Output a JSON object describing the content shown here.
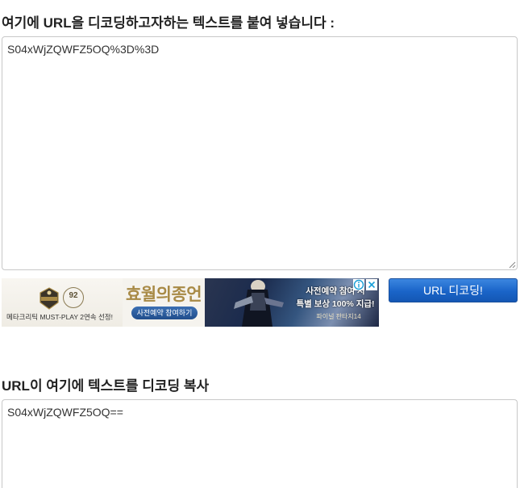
{
  "input_section": {
    "heading": "여기에 URL을 디코딩하고자하는 텍스트를 붙여 넣습니다 :",
    "value": "S04xWjZQWFZ5OQ%3D%3D"
  },
  "decode_button": {
    "label": "URL 디코딩!"
  },
  "ad": {
    "score": "92",
    "caption": "메타크리틱 MUST-PLAY 2연속 선정!",
    "title": "효월의종언",
    "preregister_label": "사전예약 참여하기",
    "reward_line1": "사전예약 참여 시",
    "reward_line2": "특별 보상 100% 지급!",
    "game_logo": "파이널 판타지14",
    "accent_color": "#a88a46"
  },
  "output_section": {
    "heading": "URL이 여기에 텍스트를 디코딩 복사",
    "value": "S04xWjZQWFZ5OQ=="
  },
  "colors": {
    "button": "#1a64c8",
    "text": "#222222",
    "border": "#c8c8c8"
  }
}
